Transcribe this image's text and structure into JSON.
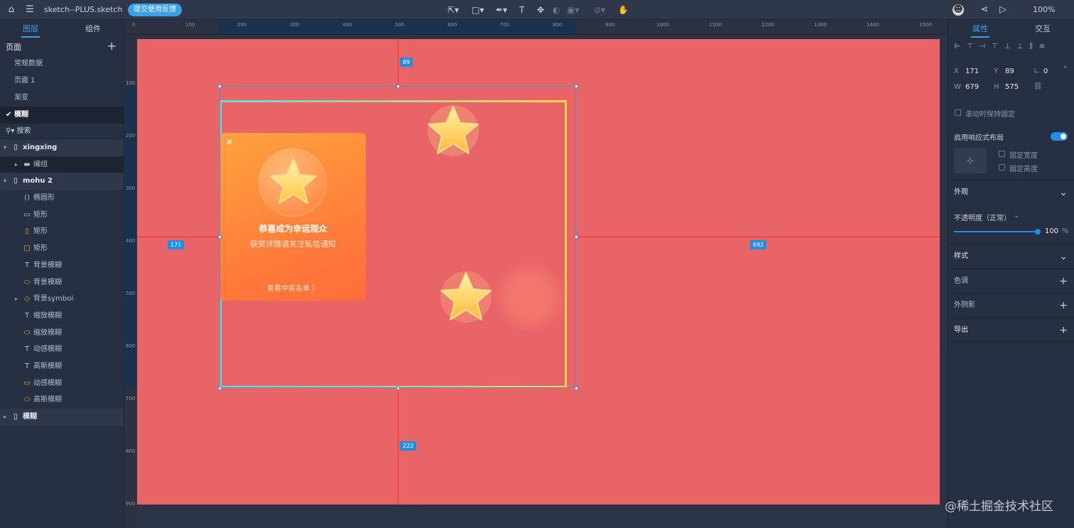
{
  "app": {
    "doc_title": "sketch--PLUS.sketch",
    "feedback": "提交使用反馈",
    "zoom": "100%"
  },
  "left": {
    "tab_layers": "图层",
    "tab_components": "组件",
    "pages_header": "页面",
    "pages": [
      "常规数据",
      "页面 1",
      "渐变",
      "模糊"
    ],
    "search": "搜索",
    "layers": [
      {
        "name": "xingxing",
        "type": "artboard"
      },
      {
        "name": "编组",
        "type": "folder"
      },
      {
        "name": "mohu 2",
        "type": "artboard"
      },
      {
        "name": "椭圆形",
        "type": "ellipse-v"
      },
      {
        "name": "矩形",
        "type": "rect"
      },
      {
        "name": "矩形",
        "type": "rect-tall"
      },
      {
        "name": "矩形",
        "type": "rect"
      },
      {
        "name": "背景模糊",
        "type": "text"
      },
      {
        "name": "背景模糊",
        "type": "ellipse"
      },
      {
        "name": "背景symbol",
        "type": "symbol"
      },
      {
        "name": "缩放模糊",
        "type": "text"
      },
      {
        "name": "缩放模糊",
        "type": "ellipse"
      },
      {
        "name": "动感模糊",
        "type": "text"
      },
      {
        "name": "高斯模糊",
        "type": "text"
      },
      {
        "name": "动感模糊",
        "type": "rect"
      },
      {
        "name": "高斯模糊",
        "type": "ellipse"
      },
      {
        "name": "模糊",
        "type": "artboard"
      }
    ]
  },
  "ruler": {
    "top": [
      "0",
      "100",
      "200",
      "300",
      "400",
      "500",
      "600",
      "700",
      "800",
      "900",
      "1000",
      "1100",
      "1200",
      "1300",
      "1400",
      "1500"
    ],
    "left": [
      "100",
      "200",
      "300",
      "400",
      "500",
      "600",
      "700",
      "800",
      "900"
    ]
  },
  "canvas": {
    "dim_top": "89",
    "dim_left": "171",
    "dim_right": "692",
    "dim_bottom": "222",
    "card": {
      "title": "恭喜成为幸运观众",
      "subtitle": "获奖详情请关注私信通知",
      "link": "查看中奖名单 〉"
    }
  },
  "right": {
    "tab_props": "属性",
    "tab_interact": "交互",
    "x_label": "X",
    "x": "171",
    "y_label": "Y",
    "y": "89",
    "angle": "0",
    "w_label": "W",
    "w": "679",
    "h_label": "H",
    "h": "575",
    "fixed_scroll": "滚动时保持固定",
    "responsive": "启用响应式布局",
    "fixed_width": "固定宽度",
    "fixed_height": "固定高度",
    "appearance": "外观",
    "opacity_label": "不透明度（正常）",
    "opacity": "100",
    "opacity_unit": "%",
    "style": "样式",
    "color_tone": "色调",
    "shadow": "外阴影",
    "export": "导出"
  },
  "watermark": "@稀土掘金技术社区"
}
